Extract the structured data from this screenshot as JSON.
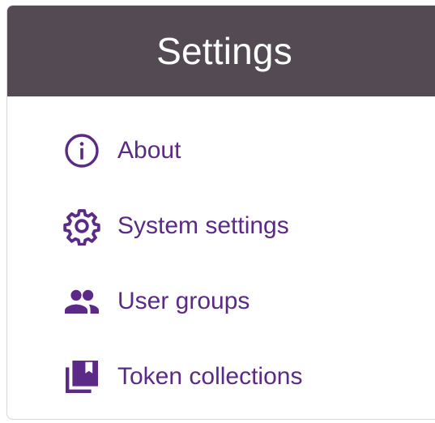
{
  "header": {
    "title": "Settings"
  },
  "colors": {
    "header_bg": "#544a53",
    "accent": "#5b2a86",
    "border": "#d8d6da"
  },
  "menu": {
    "items": [
      {
        "label": "About",
        "icon": "info-circle-icon"
      },
      {
        "label": "System settings",
        "icon": "gear-icon"
      },
      {
        "label": "User groups",
        "icon": "users-icon"
      },
      {
        "label": "Token collections",
        "icon": "collections-icon"
      }
    ]
  }
}
